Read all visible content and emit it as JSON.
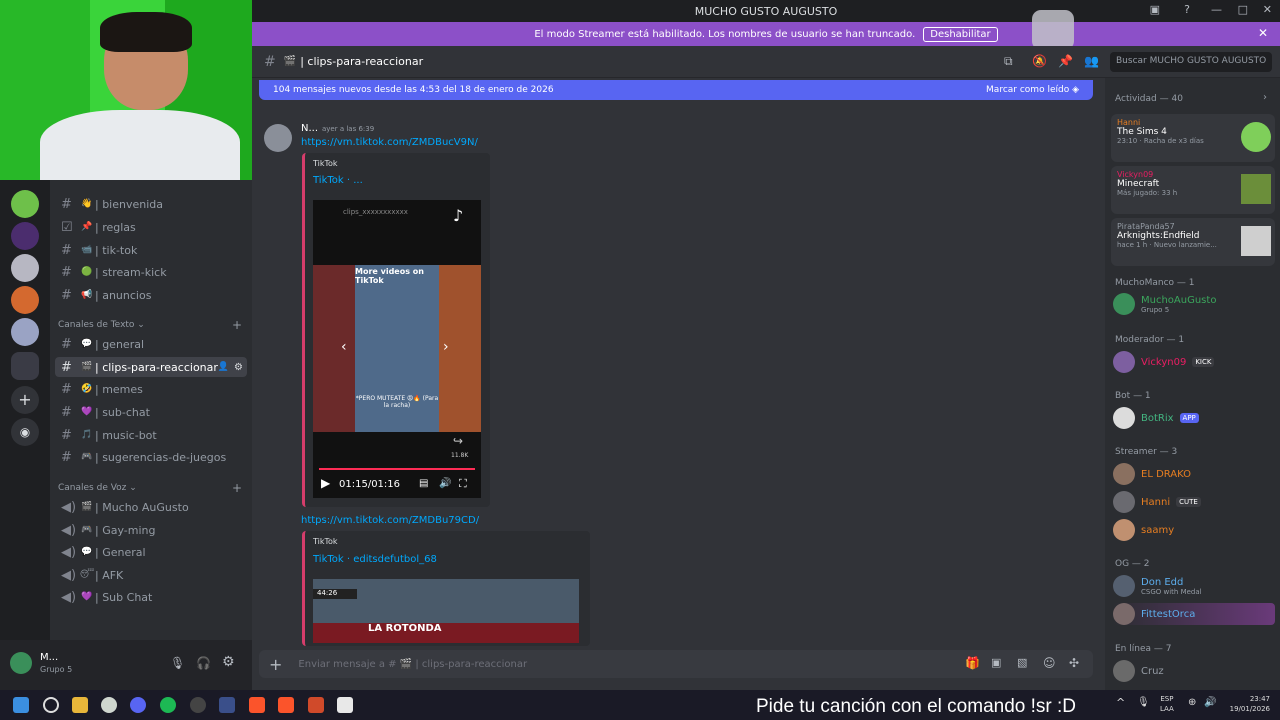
{
  "window": {
    "title": "MUCHO GUSTO AUGUSTO"
  },
  "streamer_bar": {
    "text": "El modo Streamer está habilitado. Los nombres de usuario se han truncado.",
    "button": "Deshabilitar"
  },
  "channel": {
    "name": "| clips-para-reaccionar",
    "search_placeholder": "Buscar MUCHO GUSTO AUGUSTO"
  },
  "new_messages": {
    "text": "104 mensajes nuevos desde las 4:53 del 18 de enero de 2026",
    "mark_read": "Marcar como leído"
  },
  "channels": [
    {
      "emoji": "👋",
      "name": "| bienvenida"
    },
    {
      "emoji": "📌",
      "name": "| reglas"
    },
    {
      "emoji": "📹",
      "name": "| tik-tok"
    },
    {
      "emoji": "🟢",
      "name": "| stream-kick"
    },
    {
      "emoji": "📢",
      "name": "| anuncios"
    }
  ],
  "text_category": "Canales de Texto",
  "text_channels": [
    {
      "emoji": "💬",
      "name": "| general"
    },
    {
      "emoji": "🎬",
      "name": "| clips-para-reaccionar"
    },
    {
      "emoji": "🤣",
      "name": "| memes"
    },
    {
      "emoji": "💜",
      "name": "| sub-chat"
    },
    {
      "emoji": "🎵",
      "name": "| music-bot"
    },
    {
      "emoji": "🎮",
      "name": "| sugerencias-de-juegos"
    }
  ],
  "voice_category": "Canales de Voz",
  "voice_channels": [
    {
      "emoji": "🎬",
      "name": "| Mucho AuGusto"
    },
    {
      "emoji": "🎮",
      "name": "| Gay-ming"
    },
    {
      "emoji": "💬",
      "name": "| General"
    },
    {
      "emoji": "😴",
      "name": "| AFK"
    },
    {
      "emoji": "💜",
      "name": "| Sub Chat"
    }
  ],
  "user": {
    "name": "M...",
    "status": "Grupo 5"
  },
  "message": {
    "author": "N...",
    "time": "ayer a las 6:39",
    "link1": "https://vm.tiktok.com/ZMDBucV9N/",
    "embed1": {
      "provider": "TikTok",
      "title": "TikTok · ...",
      "video_handle": "clips_xxxxxxxxxxx",
      "more": "More videos on TikTok",
      "caption": "*PERO MUTEATE 😡🔥 (Para la racha)",
      "shares": "11.8K",
      "time": "01:15/01:16"
    },
    "link2": "https://vm.tiktok.com/ZMDBu79CD/",
    "embed2": {
      "provider": "TikTok",
      "title": "TikTok · editsdefutbol_68",
      "clock": "44:26",
      "banner": "LA ROTONDA"
    }
  },
  "composer": {
    "placeholder": "Enviar mensaje a # 🎬 | clips-para-reaccionar"
  },
  "members": {
    "activity_title": "Actividad — 40",
    "activities": [
      {
        "user": "Hanni",
        "game": "The Sims 4",
        "detail": "23:10 · Racha de x3 días",
        "color": "#e67e22"
      },
      {
        "user": "Vickyn09",
        "game": "Minecraft",
        "detail": "Más jugado: 33 h",
        "color": "#e91e63"
      },
      {
        "user": "PirataPanda57",
        "game": "Arknights:Endfield",
        "detail": "hace 1 h · Nuevo lanzamie...",
        "color": "#949ba4"
      }
    ],
    "groups": [
      {
        "title": "MuchoManco — 1",
        "members": [
          {
            "name": "MuchoAuGusto",
            "sub": "Grupo 5",
            "color": "#3ba55c"
          }
        ]
      },
      {
        "title": "Moderador — 1",
        "members": [
          {
            "name": "Vickyn09",
            "badge": "KICK",
            "color": "#e91e63"
          }
        ]
      },
      {
        "title": "Bot — 1",
        "members": [
          {
            "name": "BotRix",
            "badge": "APP",
            "color": "#43b581"
          }
        ]
      },
      {
        "title": "Streamer — 3",
        "members": [
          {
            "name": "EL DRAKO",
            "color": "#e67e22"
          },
          {
            "name": "Hanni",
            "badge": "CUTE",
            "color": "#e67e22"
          },
          {
            "name": "saamy",
            "color": "#e67e22"
          }
        ]
      },
      {
        "title": "OG — 2",
        "members": [
          {
            "name": "Don Edd",
            "sub": "CSGO with Medal",
            "color": "#5dadec"
          },
          {
            "name": "FittestOrca",
            "color": "#5dadec"
          }
        ]
      },
      {
        "title": "En línea — 7",
        "members": [
          {
            "name": "Cruz",
            "color": "#949ba4"
          }
        ]
      }
    ]
  },
  "overlay": {
    "text": "Pide tu canción con el comando !sr :D"
  },
  "tray": {
    "lang": "ESP",
    "layout": "LAA",
    "time": "23:47",
    "date": "19/01/2026"
  }
}
